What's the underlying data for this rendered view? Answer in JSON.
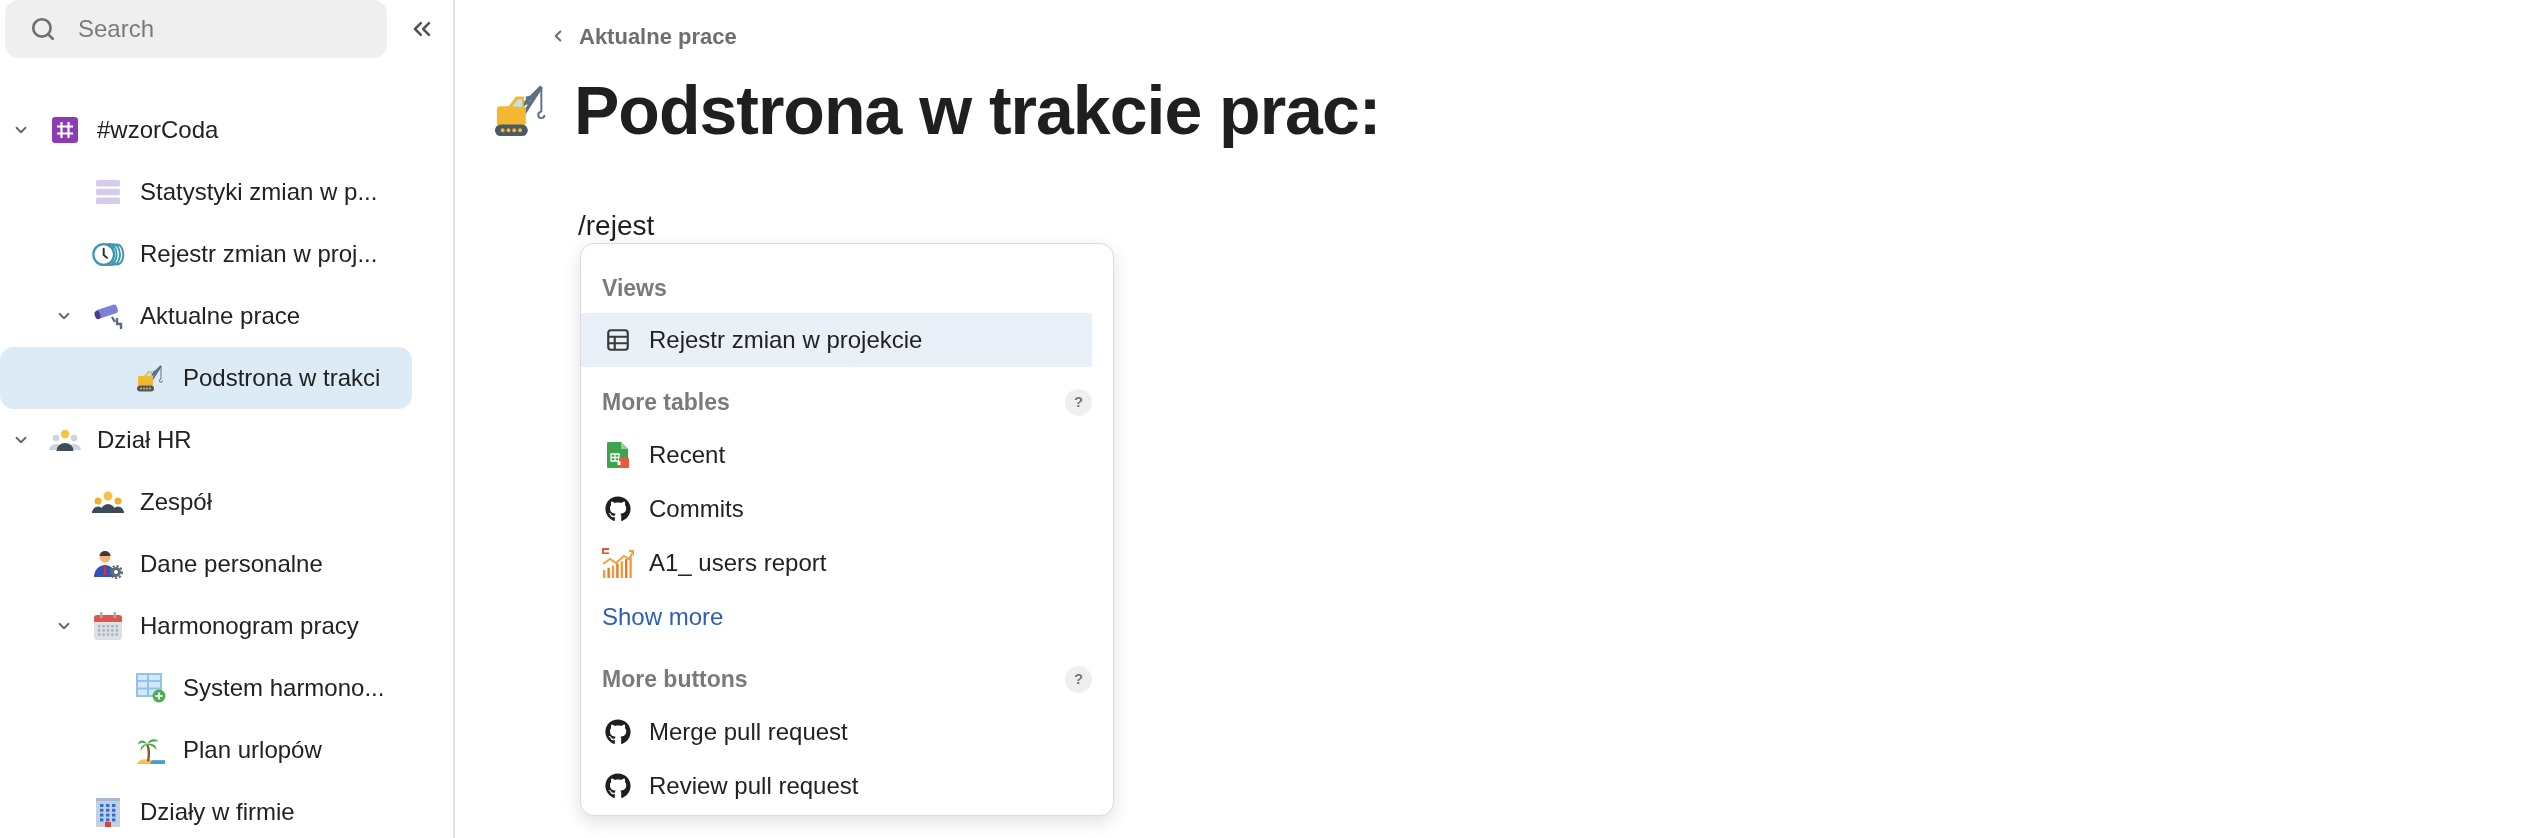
{
  "sidebar": {
    "search": {
      "placeholder": "Search"
    },
    "tree": [
      {
        "label": "#wzorCoda",
        "selected": false,
        "expanded": true,
        "children": [
          {
            "label": "Statystyki zmian w p...",
            "selected": false
          },
          {
            "label": "Rejestr zmian w proj...",
            "selected": false
          },
          {
            "label": "Aktualne prace",
            "selected": false,
            "expanded": true,
            "children": [
              {
                "label": "Podstrona w trakci",
                "selected": true
              }
            ]
          }
        ]
      },
      {
        "label": "Dział HR",
        "selected": false,
        "expanded": true,
        "children": [
          {
            "label": "Zespół",
            "selected": false
          },
          {
            "label": "Dane personalne",
            "selected": false
          },
          {
            "label": "Harmonogram pracy",
            "selected": false,
            "expanded": true,
            "children": [
              {
                "label": "System harmono...",
                "selected": false
              },
              {
                "label": "Plan urlopów",
                "selected": false
              }
            ]
          },
          {
            "label": "Działy w firmie",
            "selected": false
          }
        ]
      }
    ]
  },
  "page": {
    "breadcrumb": "Aktualne prace",
    "title": "Podstrona w trakcie prac:",
    "command_text": "/rejest",
    "menu": {
      "sections": [
        {
          "title": "Views",
          "items": [
            {
              "label": "Rejestr zmian w projekcie",
              "selected": true
            }
          ]
        },
        {
          "title": "More tables",
          "help": "?",
          "items": [
            {
              "label": "Recent",
              "selected": false
            },
            {
              "label": "Commits",
              "selected": false
            },
            {
              "label": "A1_ users report",
              "selected": false
            }
          ],
          "more_link": "Show more"
        },
        {
          "title": "More buttons",
          "help": "?",
          "items": [
            {
              "label": "Merge pull request",
              "selected": false
            },
            {
              "label": "Review pull request",
              "selected": false
            }
          ]
        }
      ]
    }
  }
}
